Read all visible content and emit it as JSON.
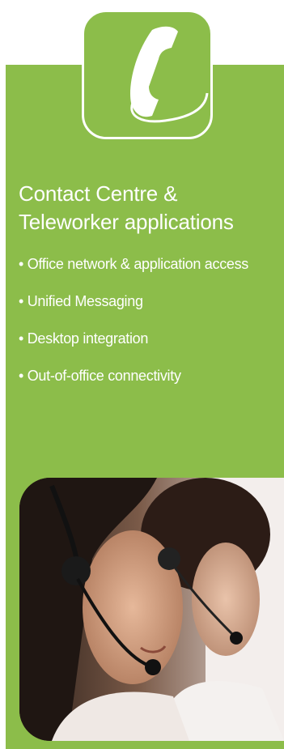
{
  "heading": {
    "line1": "Contact Centre &",
    "line2": "Teleworker applications"
  },
  "bullets": [
    "Office network & application access",
    "Unified Messaging",
    "Desktop integration",
    "Out-of-office connectivity"
  ],
  "colors": {
    "panel_green": "#8cbd4a",
    "text": "#ffffff"
  },
  "icons": {
    "tile": "telephone-handset-icon"
  },
  "photo": {
    "subject": "two women wearing headsets"
  }
}
